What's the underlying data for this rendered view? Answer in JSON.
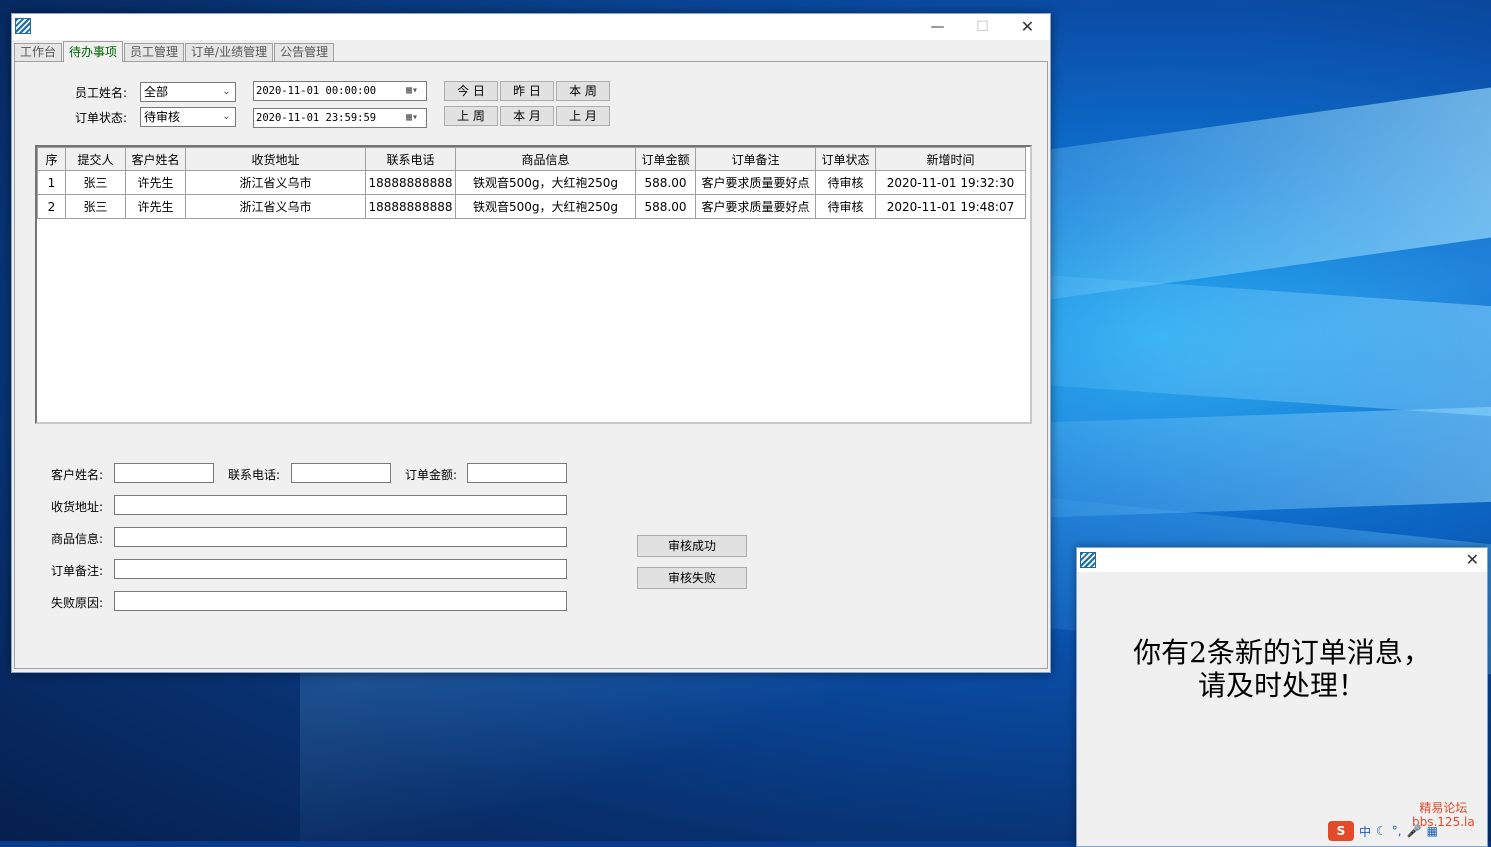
{
  "main_window": {
    "tabs": [
      {
        "label": "工作台"
      },
      {
        "label": "待办事项"
      },
      {
        "label": "员工管理"
      },
      {
        "label": "订单/业绩管理"
      },
      {
        "label": "公告管理"
      }
    ],
    "active_tab": "待办事项",
    "filters": {
      "employee_label": "员工姓名:",
      "employee_value": "全部",
      "status_label": "订单状态:",
      "status_value": "待审核",
      "start_datetime": "2020-11-01  00:00:00",
      "end_datetime": "2020-11-01  23:59:59",
      "quick_buttons": [
        "今 日",
        "昨 日",
        "本 周",
        "上 周",
        "本 月",
        "上 月"
      ]
    },
    "table": {
      "columns": [
        "序",
        "提交人",
        "客户姓名",
        "收货地址",
        "联系电话",
        "商品信息",
        "订单金额",
        "订单备注",
        "订单状态",
        "新增时间"
      ],
      "rows": [
        [
          "1",
          "张三",
          "许先生",
          "浙江省义乌市",
          "18888888888",
          "铁观音500g，大红袍250g",
          "588.00",
          "客户要求质量要好点",
          "待审核",
          "2020-11-01 19:32:30"
        ],
        [
          "2",
          "张三",
          "许先生",
          "浙江省义乌市",
          "18888888888",
          "铁观音500g，大红袍250g",
          "588.00",
          "客户要求质量要好点",
          "待审核",
          "2020-11-01 19:48:07"
        ]
      ]
    },
    "form": {
      "customer_label": "客户姓名:",
      "phone_label": "联系电话:",
      "amount_label": "订单金额:",
      "address_label": "收货地址:",
      "goods_label": "商品信息:",
      "remark_label": "订单备注:",
      "fail_reason_label": "失败原因:",
      "approve_button": "审核成功",
      "reject_button": "审核失败"
    },
    "title_buttons": {
      "minimize": "—",
      "maximize": "☐",
      "close": "✕"
    }
  },
  "popup": {
    "message_line1": "你有2条新的订单消息，",
    "message_line2": "请及时处理！",
    "close": "✕"
  },
  "watermark": {
    "line1": "精易论坛",
    "line2": "bbs.125.la"
  },
  "tray": {
    "ime_logo": "S",
    "ime_mode": "中",
    "icons": [
      "moon-icon",
      "punctuation-icon",
      "mic-icon",
      "keyboard-icon"
    ]
  }
}
